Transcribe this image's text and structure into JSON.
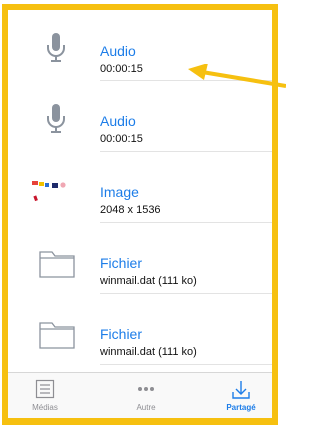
{
  "items": [
    {
      "title": "Audio",
      "subtitle": "00:00:15",
      "icon": "microphone-icon"
    },
    {
      "title": "Audio",
      "subtitle": "00:00:15",
      "icon": "microphone-icon"
    },
    {
      "title": "Image",
      "subtitle": "2048 x 1536",
      "icon": "image-thumbnail"
    },
    {
      "title": "Fichier",
      "subtitle": "winmail.dat (111 ko)",
      "icon": "folder-icon"
    },
    {
      "title": "Fichier",
      "subtitle": "winmail.dat (111 ko)",
      "icon": "folder-icon"
    }
  ],
  "tabs": [
    {
      "label": "Médias",
      "icon": "list-icon",
      "active": false
    },
    {
      "label": "Autre",
      "icon": "more-icon",
      "active": false
    },
    {
      "label": "Partagé",
      "icon": "share-download-icon",
      "active": true
    }
  ],
  "colors": {
    "accent": "#1d7de8",
    "highlight": "#f6c010"
  }
}
